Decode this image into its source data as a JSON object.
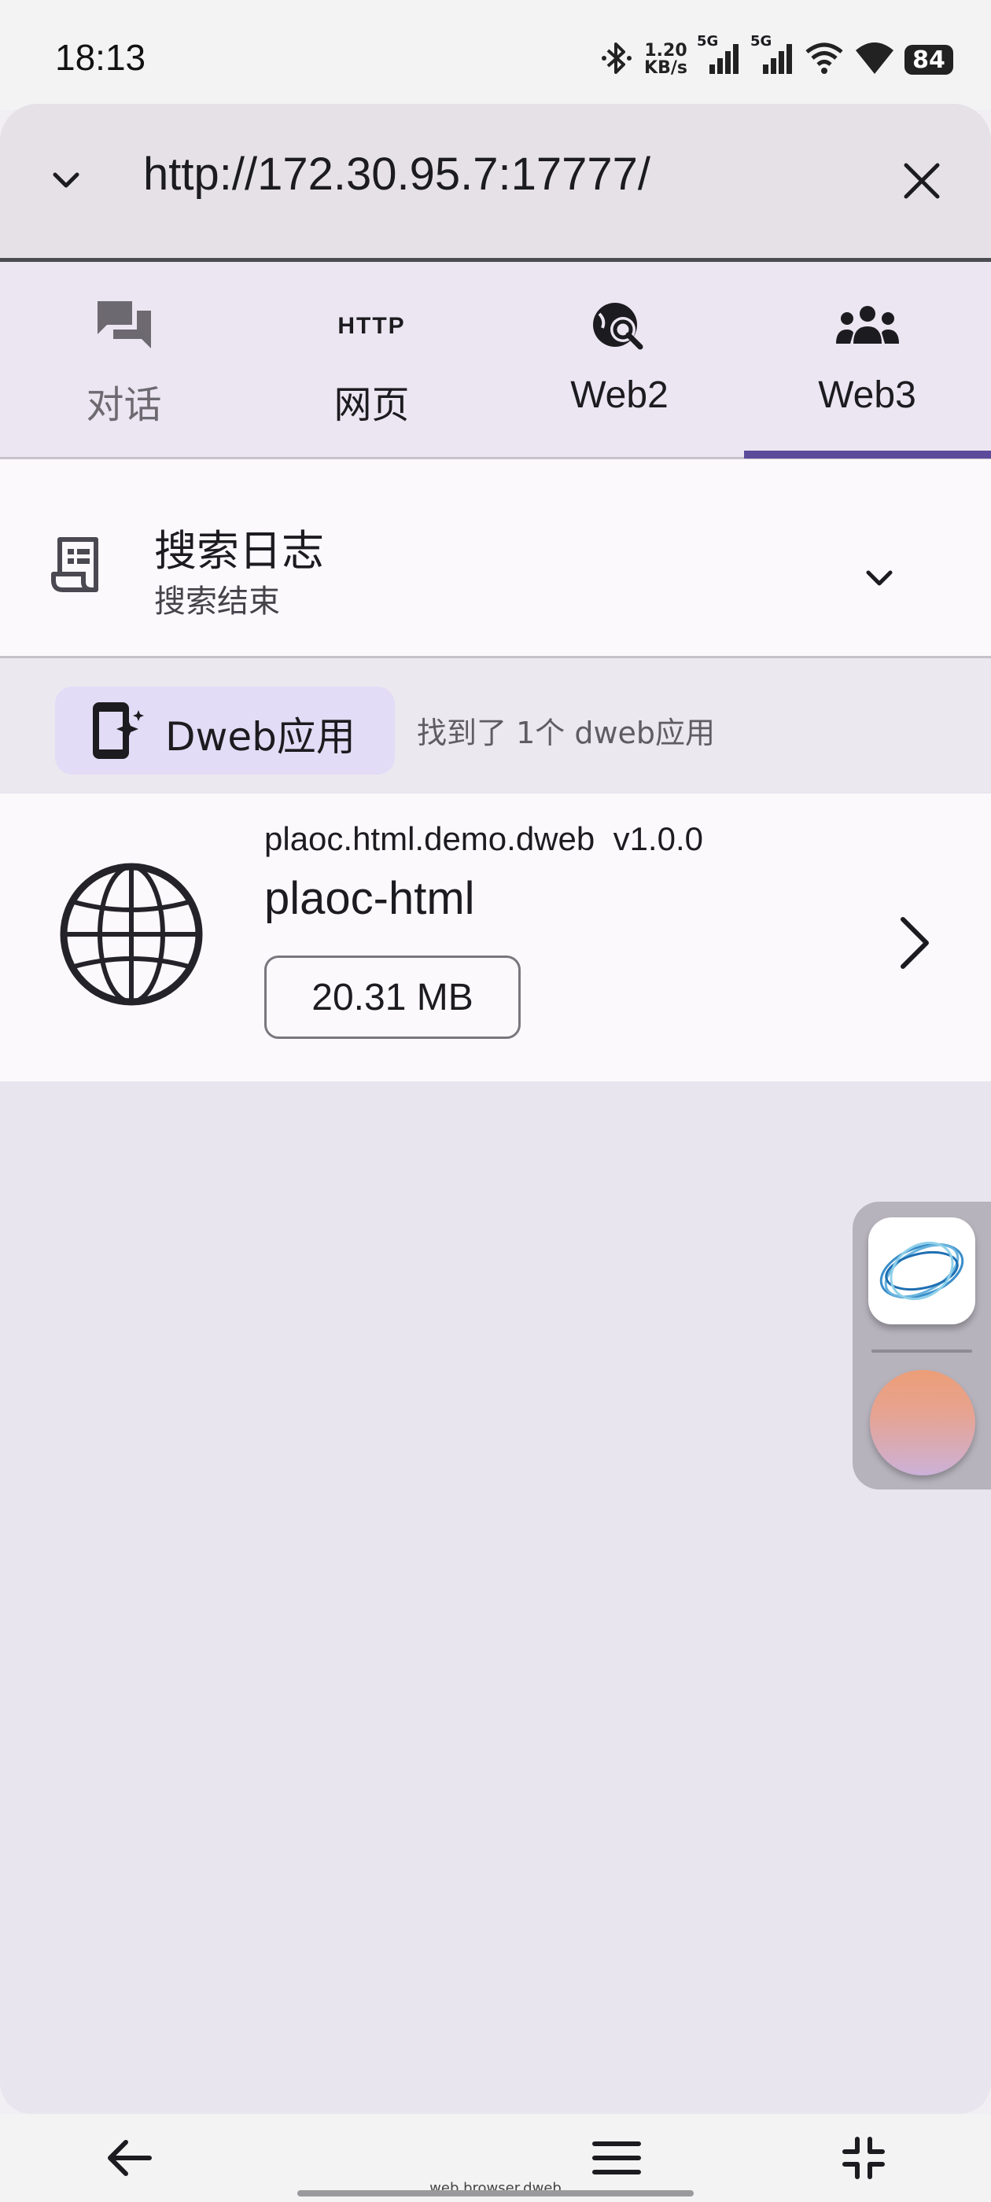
{
  "status_bar": {
    "time": "18:13",
    "net_speed_value": "1.20",
    "net_speed_unit": "KB/s",
    "signal1_label": "5G",
    "signal2_label": "5G",
    "battery": "84",
    "icons": [
      "bluetooth-icon",
      "signal-icon",
      "signal-icon",
      "wifi-icon",
      "wifi-icon",
      "battery-icon"
    ]
  },
  "url_bar": {
    "url": "http://172.30.95.7:17777/",
    "icons": [
      "chevron-down-icon",
      "close-icon"
    ]
  },
  "tabs": [
    {
      "label": "对话",
      "icon": "chat-icon",
      "selected": false
    },
    {
      "label": "网页",
      "icon": "http-icon",
      "selected": false
    },
    {
      "label": "Web2",
      "icon": "web-search-icon",
      "selected": false
    },
    {
      "label": "Web3",
      "icon": "groups-icon",
      "selected": true
    }
  ],
  "http_icon_text": "HTTP",
  "search_log": {
    "title": "搜索日志",
    "subtitle": "搜索结束",
    "icons": [
      "receipt-icon",
      "chevron-down-icon"
    ]
  },
  "dweb": {
    "chip_label": "Dweb应用",
    "found_text": "找到了 1个 dweb应用",
    "icon": "app-shortcut-icon"
  },
  "app": {
    "id": "plaoc.html.demo.dweb",
    "version": "v1.0.0",
    "name": "plaoc-html",
    "size": "20.31 MB",
    "icons": [
      "globe-icon",
      "chevron-right-icon"
    ]
  },
  "colors": {
    "accent": "#5c4b9a",
    "chip_bg": "#e3dcf6",
    "sheet_bg": "#e9e5ee"
  },
  "nav_bar": {
    "caption": "web.browser.dweb",
    "icons": [
      "back-arrow-icon",
      "menu-icon",
      "collapse-icon"
    ]
  }
}
